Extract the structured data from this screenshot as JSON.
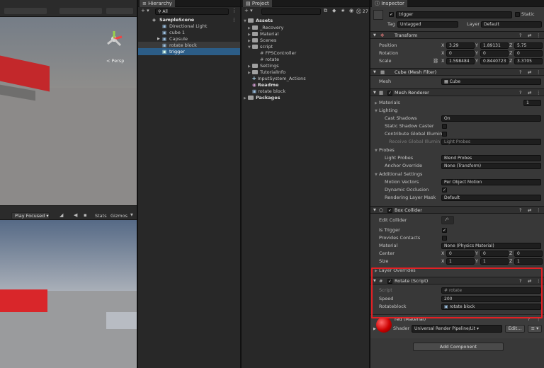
{
  "scene": {
    "gizmo_label": "< Persp"
  },
  "game": {
    "play_focused": "Play Focused",
    "stats": "Stats",
    "gizmos": "Gizmos"
  },
  "hierarchy": {
    "tab": "Hierarchy",
    "search_placeholder": "All",
    "scene_name": "SampleScene",
    "items": [
      "Directional Light",
      "cube 1",
      "Capsule",
      "rotate block",
      "trigger"
    ]
  },
  "project": {
    "tab": "Project",
    "count": "27",
    "assets": "Assets",
    "folders": [
      "_Recovery",
      "Material",
      "Scenes",
      "script"
    ],
    "scripts": [
      "FPSController",
      "rotate"
    ],
    "folders2": [
      "Settings",
      "TutorialInfo",
      "InputSystem_Actions",
      "Readme",
      "rotate block"
    ],
    "packages": "Packages"
  },
  "inspector": {
    "tab": "Inspector",
    "object_name": "trigger",
    "static_label": "Static",
    "tag_label": "Tag",
    "tag_value": "Untagged",
    "layer_label": "Layer",
    "layer_value": "Default",
    "transform": {
      "title": "Transform",
      "position_label": "Position",
      "rotation_label": "Rotation",
      "scale_label": "Scale",
      "position": [
        "3.29",
        "1.89131",
        "5.75"
      ],
      "rotation": [
        "0",
        "0",
        "0"
      ],
      "scale": [
        "1.598484",
        "0.8440723",
        "3.3705"
      ]
    },
    "mesh_filter": {
      "title": "Cube (Mesh Filter)",
      "mesh_label": "Mesh",
      "mesh_value": "Cube"
    },
    "mesh_renderer": {
      "title": "Mesh Renderer",
      "materials_label": "Materials",
      "materials_count": "1",
      "lighting_label": "Lighting",
      "cast_shadows_label": "Cast Shadows",
      "cast_shadows_value": "On",
      "static_shadow_caster": "Static Shadow Caster",
      "contribute_gi": "Contribute Global Illumin",
      "receive_gi": "Receive Global Illumin",
      "receive_gi_value": "Light Probes",
      "probes_label": "Probes",
      "light_probes_label": "Light Probes",
      "light_probes_value": "Blend Probes",
      "anchor_override_label": "Anchor Override",
      "anchor_override_value": "None (Transform)",
      "additional_label": "Additional Settings",
      "motion_vectors_label": "Motion Vectors",
      "motion_vectors_value": "Per Object Motion",
      "dynamic_occlusion_label": "Dynamic Occlusion",
      "rendering_layer_label": "Rendering Layer Mask",
      "rendering_layer_value": "Default"
    },
    "box_collider": {
      "title": "Box Collider",
      "edit_collider": "Edit Collider",
      "is_trigger": "Is Trigger",
      "provides_contacts": "Provides Contacts",
      "material_label": "Material",
      "material_value": "None (Physics Material)",
      "center_label": "Center",
      "center": [
        "0",
        "0",
        "0"
      ],
      "size_label": "Size",
      "size": [
        "1",
        "1",
        "1"
      ]
    },
    "layer_overrides": "Layer Overrides",
    "rotate_script": {
      "title": "Rotate (Script)",
      "script_label": "Script",
      "script_value": "rotate",
      "speed_label": "Speed",
      "speed_value": "200",
      "rotateblock_label": "Rotateblock",
      "rotateblock_value": "rotate block"
    },
    "material": {
      "name": "red (Material)",
      "shader_label": "Shader",
      "shader_value": "Universal Render Pipeline/Lit",
      "edit": "Edit..."
    },
    "add_component": "Add Component",
    "axes": [
      "X",
      "Y",
      "Z"
    ]
  },
  "colors": {
    "highlight_box": "#e32024",
    "selection": "#2c5d87",
    "red_object": "#d4262a"
  }
}
